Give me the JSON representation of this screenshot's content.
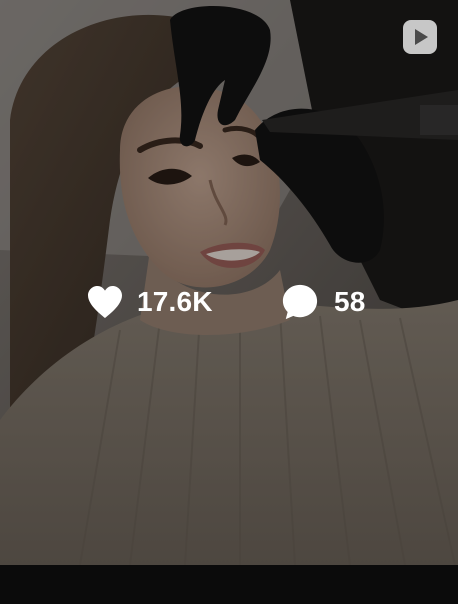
{
  "post": {
    "media_type_icon": "reel-play-icon",
    "likes": "17.6K",
    "comments": "58",
    "like_icon": "heart-icon",
    "comment_icon": "comment-bubble-icon"
  },
  "colors": {
    "overlay_text": "#ffffff",
    "background": "#0b0b0b"
  }
}
